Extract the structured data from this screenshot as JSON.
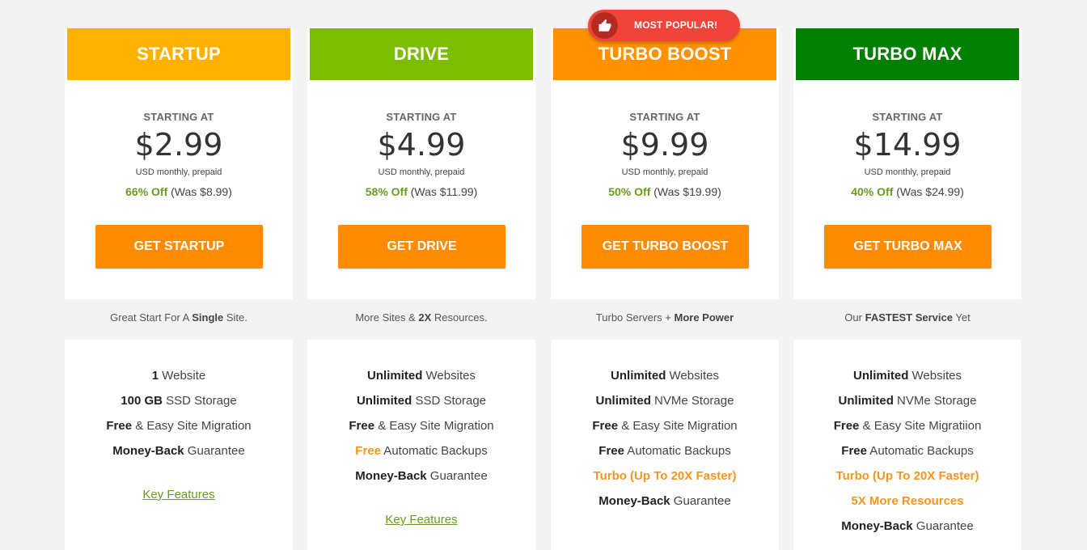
{
  "colors": {
    "startup": "#ffb000",
    "drive": "#7cbd00",
    "turbo_boost": "#ff9000",
    "turbo_max": "#007f00",
    "cta": "#ff8c00",
    "discount": "#6a9a22",
    "badge": "#f0433a"
  },
  "badge": {
    "icon": "thumbs-up-icon",
    "label": "MOST POPULAR!"
  },
  "plans": [
    {
      "name": "STARTUP",
      "starting_at": "STARTING AT",
      "price": "$2.99",
      "billing": "USD monthly, prepaid",
      "discount": "66% Off",
      "was": "(Was $8.99)",
      "cta": "GET STARTUP",
      "tagline": {
        "pre": "Great Start For A ",
        "bold": "Single",
        "post": " Site."
      },
      "features": [
        {
          "bold": "1",
          "text": " Website"
        },
        {
          "bold": "100 GB",
          "text": " SSD Storage"
        },
        {
          "bold": "Free",
          "text": " & Easy Site Migration"
        },
        {
          "bold": "Money-Back",
          "text": " Guarantee"
        }
      ],
      "key_features": "Key Features"
    },
    {
      "name": "DRIVE",
      "starting_at": "STARTING AT",
      "price": "$4.99",
      "billing": "USD monthly, prepaid",
      "discount": "58% Off",
      "was": "(Was $11.99)",
      "cta": "GET DRIVE",
      "tagline": {
        "pre": "More Sites & ",
        "bold": "2X",
        "post": " Resources."
      },
      "features": [
        {
          "bold": "Unlimited",
          "text": " Websites"
        },
        {
          "bold": "Unlimited",
          "text": " SSD Storage"
        },
        {
          "bold": "Free",
          "text": " & Easy Site Migration"
        },
        {
          "orange": "Free",
          "text": " Automatic Backups"
        },
        {
          "bold": "Money-Back",
          "text": " Guarantee"
        }
      ],
      "key_features": "Key Features"
    },
    {
      "name": "TURBO BOOST",
      "starting_at": "STARTING AT",
      "price": "$9.99",
      "billing": "USD monthly, prepaid",
      "discount": "50% Off",
      "was": "(Was $19.99)",
      "cta": "GET TURBO BOOST",
      "tagline": {
        "pre": "Turbo Servers + ",
        "bold": "More Power",
        "post": ""
      },
      "features": [
        {
          "bold": "Unlimited",
          "text": " Websites"
        },
        {
          "bold": "Unlimited",
          "text": " NVMe Storage"
        },
        {
          "bold": "Free",
          "text": " & Easy Site Migration"
        },
        {
          "bold": "Free",
          "text": " Automatic Backups"
        },
        {
          "orange": "Turbo (Up To 20X Faster)",
          "text": ""
        },
        {
          "bold": "Money-Back",
          "text": " Guarantee"
        }
      ]
    },
    {
      "name": "TURBO MAX",
      "starting_at": "STARTING AT",
      "price": "$14.99",
      "billing": "USD monthly, prepaid",
      "discount": "40% Off",
      "was": "(Was $24.99)",
      "cta": "GET TURBO MAX",
      "tagline": {
        "pre": "Our ",
        "bold": "FASTEST Service",
        "post": " Yet"
      },
      "features": [
        {
          "bold": "Unlimited",
          "text": " Websites"
        },
        {
          "bold": "Unlimited",
          "text": " NVMe Storage"
        },
        {
          "bold": "Free",
          "text": " & Easy Site Migratiion"
        },
        {
          "bold": "Free",
          "text": " Automatic Backups"
        },
        {
          "orange": "Turbo (Up To 20X Faster)",
          "text": ""
        },
        {
          "orange": "5X More Resources",
          "text": ""
        },
        {
          "bold": "Money-Back",
          "text": " Guarantee"
        }
      ]
    }
  ]
}
